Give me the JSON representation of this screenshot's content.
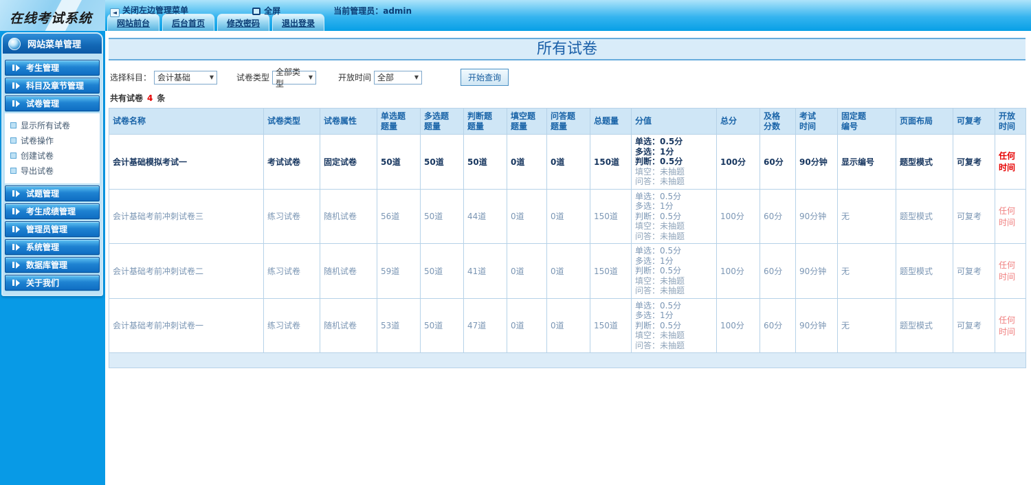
{
  "logo": {
    "title": "在线考试系统"
  },
  "topbar": {
    "close_menu": "关闭左边管理菜单",
    "fullscreen": "全屏",
    "admin_label": "当前管理员：admin",
    "tabs": [
      "网站前台",
      "后台首页",
      "修改密码",
      "退出登录"
    ]
  },
  "sidebar": {
    "header": "网站菜单管理",
    "groups": [
      {
        "label": "考生管理",
        "children": []
      },
      {
        "label": "科目及章节管理",
        "children": []
      },
      {
        "label": "试卷管理",
        "children": [
          "显示所有试卷",
          "试卷操作",
          "创建试卷",
          "导出试卷"
        ]
      },
      {
        "label": "试题管理",
        "children": []
      },
      {
        "label": "考生成绩管理",
        "children": []
      },
      {
        "label": "管理员管理",
        "children": []
      },
      {
        "label": "系统管理",
        "children": []
      },
      {
        "label": "数据库管理",
        "children": []
      },
      {
        "label": "关于我们",
        "children": []
      }
    ]
  },
  "main": {
    "title": "所有试卷",
    "filters": {
      "subject_label": "选择科目：",
      "subject_value": "会计基础",
      "type_label": "试卷类型",
      "type_value": "全部类型",
      "time_label": "开放时间",
      "time_value": "全部",
      "search_button": "开始查询"
    },
    "summary": {
      "prefix": "共有试卷",
      "count": "4",
      "suffix": "条"
    },
    "table": {
      "headers": [
        "试卷名称",
        "试卷类型",
        "试卷属性",
        "单选题\n题量",
        "多选题\n题量",
        "判断题\n题量",
        "填空题\n题量",
        "问答题\n题量",
        "总题量",
        "分值",
        "总分",
        "及格\n分数",
        "考试\n时间",
        "固定题\n编号",
        "页面布局",
        "可复考",
        "开放时间"
      ],
      "rows": [
        {
          "name": "会计基础模拟考试一",
          "type": "考试试卷",
          "attribute": "固定试卷",
          "single": "50道",
          "multiple": "50道",
          "judge": "50道",
          "blank": "0道",
          "qa": "0道",
          "total": "150道",
          "score_main": [
            "单选：0.5分",
            "多选：1分",
            "判断：0.5分"
          ],
          "score_muted": [
            "填空：未抽题",
            "问答：未抽题"
          ],
          "total_score": "100分",
          "pass_score": "60分",
          "exam_time": "90分钟",
          "fixed_number": "显示编号",
          "layout": "题型模式",
          "retake": "可复考",
          "open_time": "任何时间",
          "emphasized": true
        },
        {
          "name": "会计基础考前冲刺试卷三",
          "type": "练习试卷",
          "attribute": "随机试卷",
          "single": "56道",
          "multiple": "50道",
          "judge": "44道",
          "blank": "0道",
          "qa": "0道",
          "total": "150道",
          "score_main": [
            "单选：0.5分",
            "多选：1分",
            "判断：0.5分"
          ],
          "score_muted": [
            "填空：未抽题",
            "问答：未抽题"
          ],
          "total_score": "100分",
          "pass_score": "60分",
          "exam_time": "90分钟",
          "fixed_number": "无",
          "layout": "题型模式",
          "retake": "可复考",
          "open_time": "任何时间",
          "emphasized": false
        },
        {
          "name": "会计基础考前冲刺试卷二",
          "type": "练习试卷",
          "attribute": "随机试卷",
          "single": "59道",
          "multiple": "50道",
          "judge": "41道",
          "blank": "0道",
          "qa": "0道",
          "total": "150道",
          "score_main": [
            "单选：0.5分",
            "多选：1分",
            "判断：0.5分"
          ],
          "score_muted": [
            "填空：未抽题",
            "问答：未抽题"
          ],
          "total_score": "100分",
          "pass_score": "60分",
          "exam_time": "90分钟",
          "fixed_number": "无",
          "layout": "题型模式",
          "retake": "可复考",
          "open_time": "任何时间",
          "emphasized": false
        },
        {
          "name": "会计基础考前冲刺试卷一",
          "type": "练习试卷",
          "attribute": "随机试卷",
          "single": "53道",
          "multiple": "50道",
          "judge": "47道",
          "blank": "0道",
          "qa": "0道",
          "total": "150道",
          "score_main": [
            "单选：0.5分",
            "多选：1分",
            "判断：0.5分"
          ],
          "score_muted": [
            "填空：未抽题",
            "问答：未抽题"
          ],
          "total_score": "100分",
          "pass_score": "60分",
          "exam_time": "90分钟",
          "fixed_number": "无",
          "layout": "题型模式",
          "retake": "可复考",
          "open_time": "任何时间",
          "emphasized": false
        }
      ]
    }
  },
  "colors": {
    "topbar_blue": "#07a0e6",
    "sidebar_blue": "#089ae6",
    "title_blue": "#1a5fa8",
    "table_header_blue": "#1a64a8",
    "row_emphasis_navy": "#17365f",
    "row_muted_blue": "#7b96b4",
    "accent_red": "#e60000",
    "muted_red": "#f08080"
  }
}
